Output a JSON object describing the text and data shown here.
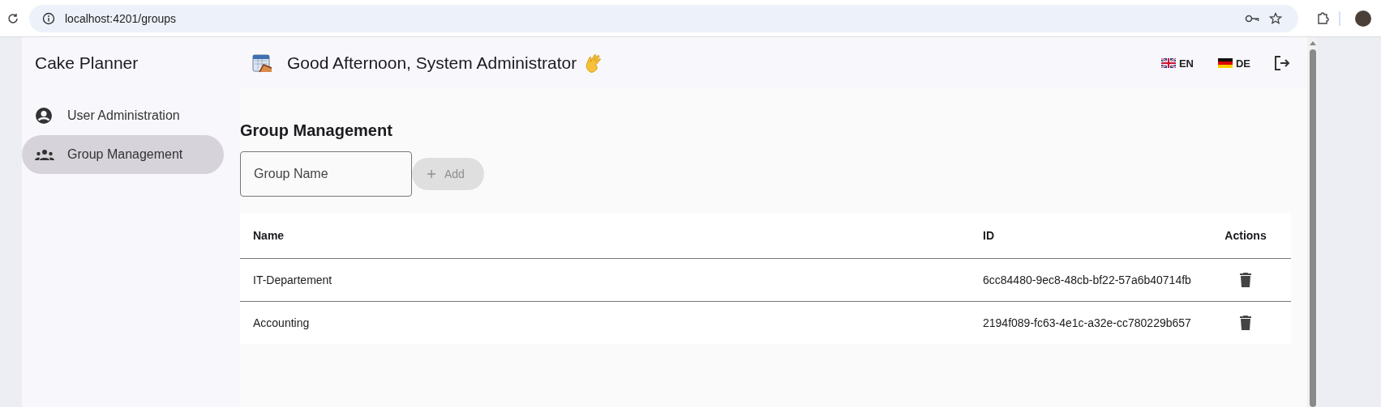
{
  "browser": {
    "url": "localhost:4201/groups"
  },
  "app": {
    "title": "Cake Planner",
    "greeting": "Good Afternoon, System Administrator"
  },
  "languages": [
    {
      "code": "EN",
      "kind": "uk"
    },
    {
      "code": "DE",
      "kind": "de"
    }
  ],
  "sidebar": {
    "items": [
      {
        "label": "User Administration",
        "kind": "user",
        "selected": false
      },
      {
        "label": "Group Management",
        "kind": "group",
        "selected": true
      }
    ]
  },
  "page": {
    "heading": "Group Management",
    "input": {
      "placeholder": "Group Name"
    },
    "add_button": {
      "label": "Add",
      "disabled": true
    }
  },
  "table": {
    "columns": [
      "Name",
      "ID",
      "Actions"
    ],
    "rows": [
      {
        "name": "IT-Departement",
        "id": "6cc84480-9ec8-48cb-bf22-57a6b40714fb"
      },
      {
        "name": "Accounting",
        "id": "2194f089-fc63-4e1c-a32e-cc780229b657"
      }
    ]
  }
}
